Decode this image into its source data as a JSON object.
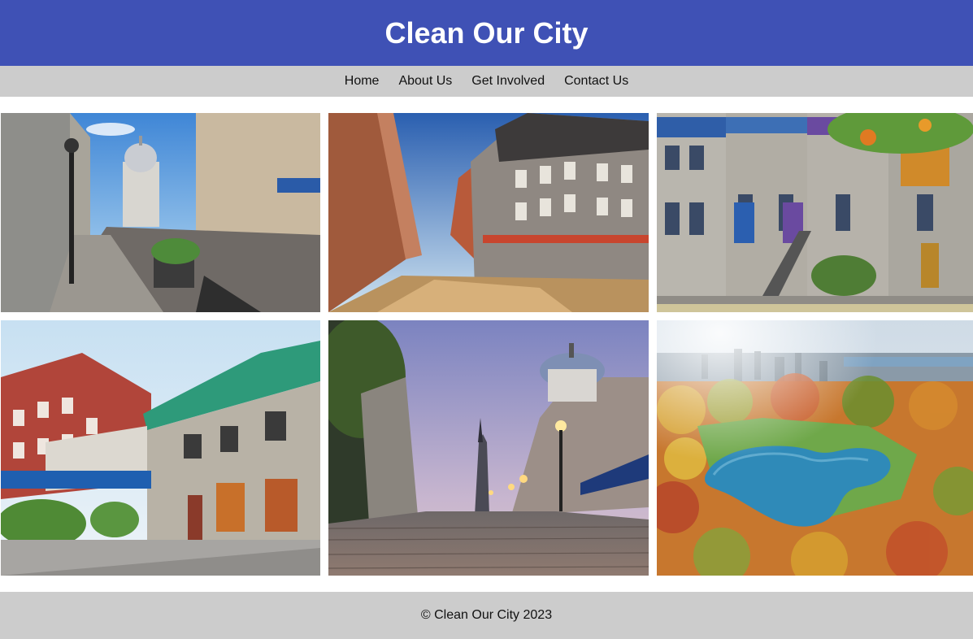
{
  "header": {
    "title": "Clean Our City"
  },
  "nav": {
    "items": [
      {
        "label": "Home"
      },
      {
        "label": "About Us"
      },
      {
        "label": "Get Involved"
      },
      {
        "label": "Contact Us"
      }
    ]
  },
  "gallery": {
    "images": [
      {
        "subject": "old-street-with-domed-market"
      },
      {
        "subject": "corner-stone-building"
      },
      {
        "subject": "colorful-victorian-rowhouses"
      },
      {
        "subject": "hotel-nelson-corner"
      },
      {
        "subject": "cobblestone-street-dusk-dome"
      },
      {
        "subject": "aerial-park-pond-autumn"
      }
    ]
  },
  "footer": {
    "text": "© Clean Our City 2023"
  },
  "colors": {
    "header_bg": "#3f51b5",
    "nav_bg": "#cccccc",
    "footer_bg": "#cccccc",
    "header_text": "#ffffff"
  }
}
